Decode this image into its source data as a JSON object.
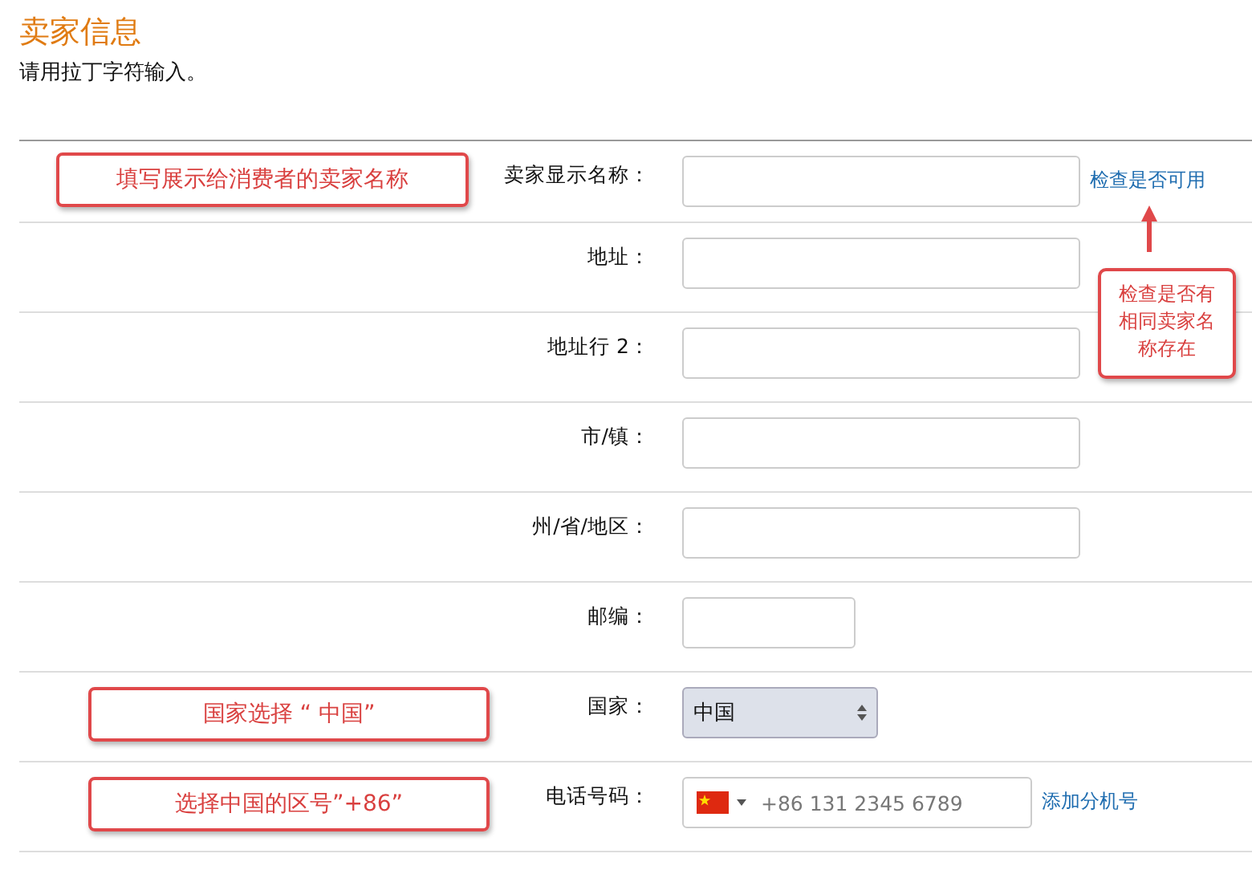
{
  "header": {
    "title": "卖家信息",
    "subtitle": "请用拉丁字符输入。"
  },
  "rows": [
    {
      "label": "卖家显示名称：",
      "kind": "text",
      "note": "填写展示给消费者的卖家名称",
      "link": "检查是否可用",
      "callout": "检查是否有相同卖家名称存在"
    },
    {
      "label": "地址：",
      "kind": "text"
    },
    {
      "label": "地址行 2：",
      "kind": "text"
    },
    {
      "label": "市/镇：",
      "kind": "text"
    },
    {
      "label": "州/省/地区：",
      "kind": "text"
    },
    {
      "label": "邮编：",
      "kind": "short_text"
    },
    {
      "label": "国家：",
      "kind": "select",
      "value": "中国",
      "note": "国家选择 “ 中国”"
    },
    {
      "label": "电话号码：",
      "kind": "phone",
      "placeholder": "+86 131 2345 6789",
      "note": "选择中国的区号”+86”",
      "link": "添加分机号"
    }
  ]
}
